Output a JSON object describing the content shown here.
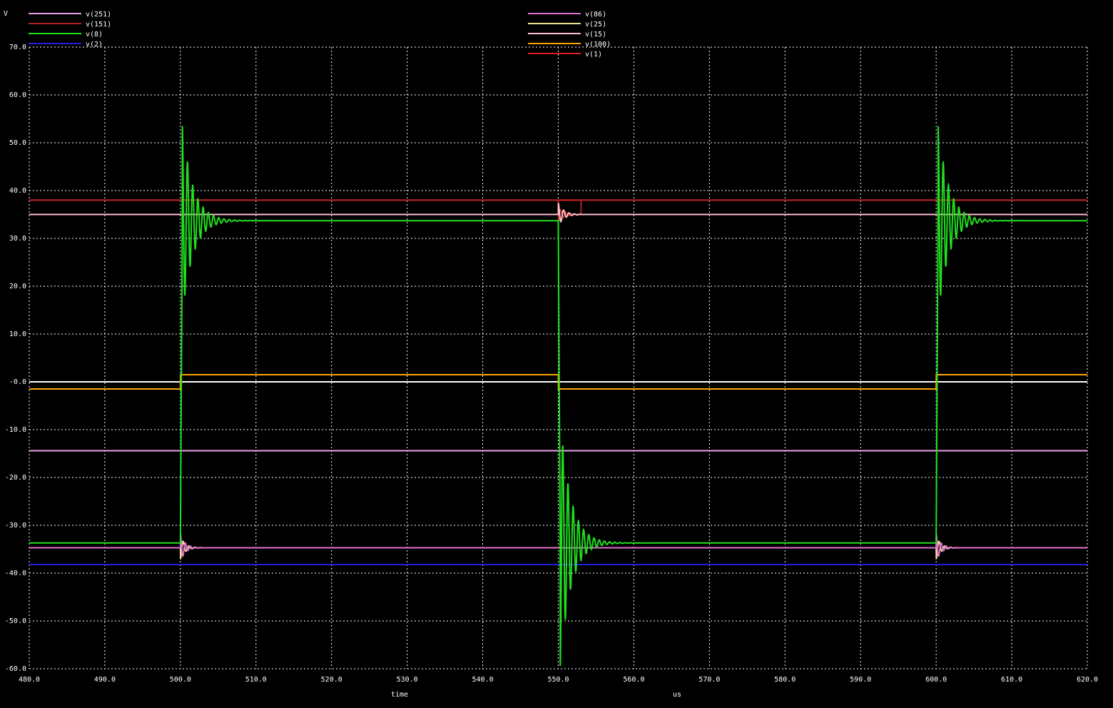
{
  "chart_data": {
    "type": "line",
    "ylabel": "V",
    "xlabel": "time",
    "xunit": "us",
    "xlim": [
      480,
      620
    ],
    "ylim": [
      -60,
      70
    ],
    "grid": true,
    "legend_placement": "top",
    "x_ticks": [
      "480.0",
      "490.0",
      "500.0",
      "510.0",
      "520.0",
      "530.0",
      "540.0",
      "550.0",
      "560.0",
      "570.0",
      "580.0",
      "590.0",
      "600.0",
      "610.0",
      "620.0"
    ],
    "y_ticks": [
      "70.0",
      "60.0",
      "50.0",
      "40.0",
      "30.0",
      "20.0",
      "10.0",
      "-0.0",
      "-10.0",
      "-20.0",
      "-30.0",
      "-40.0",
      "-50.0",
      "-60.0"
    ],
    "series": [
      {
        "name": "v(251)",
        "color": "#e8a0e8",
        "kind": "const",
        "value": -14.4
      },
      {
        "name": "v(151)",
        "color": "#b22222",
        "kind": "pulse_upper",
        "hi": 38.0,
        "lo": 35.0
      },
      {
        "name": "v(8)",
        "color": "#20e020",
        "kind": "switch_main",
        "hi": 33.7,
        "lo": -33.7
      },
      {
        "name": "v(2)",
        "color": "#2020e0",
        "kind": "const",
        "value": -38.2
      },
      {
        "name": "v(86)",
        "color": "#e070d0",
        "kind": "pulse_lower",
        "hi": -34.7,
        "lo": -34.7
      },
      {
        "name": "v(25)",
        "color": "#f0e090",
        "kind": "const_ring_low",
        "value": -34.7
      },
      {
        "name": "v(15)",
        "color": "#ffc0cb",
        "kind": "const_ring_high",
        "value": 35.0
      },
      {
        "name": "v(100)",
        "color": "#ffa500",
        "kind": "square",
        "hi": 1.5,
        "lo": -1.5
      },
      {
        "name": "v(1)",
        "color": "#e02020",
        "kind": "const",
        "value": 38.0
      }
    ],
    "extra_traces": [
      {
        "color": "#ffffff",
        "kind": "const",
        "value": 0.0
      }
    ],
    "edges": [
      500.0,
      550.0,
      600.0
    ]
  }
}
